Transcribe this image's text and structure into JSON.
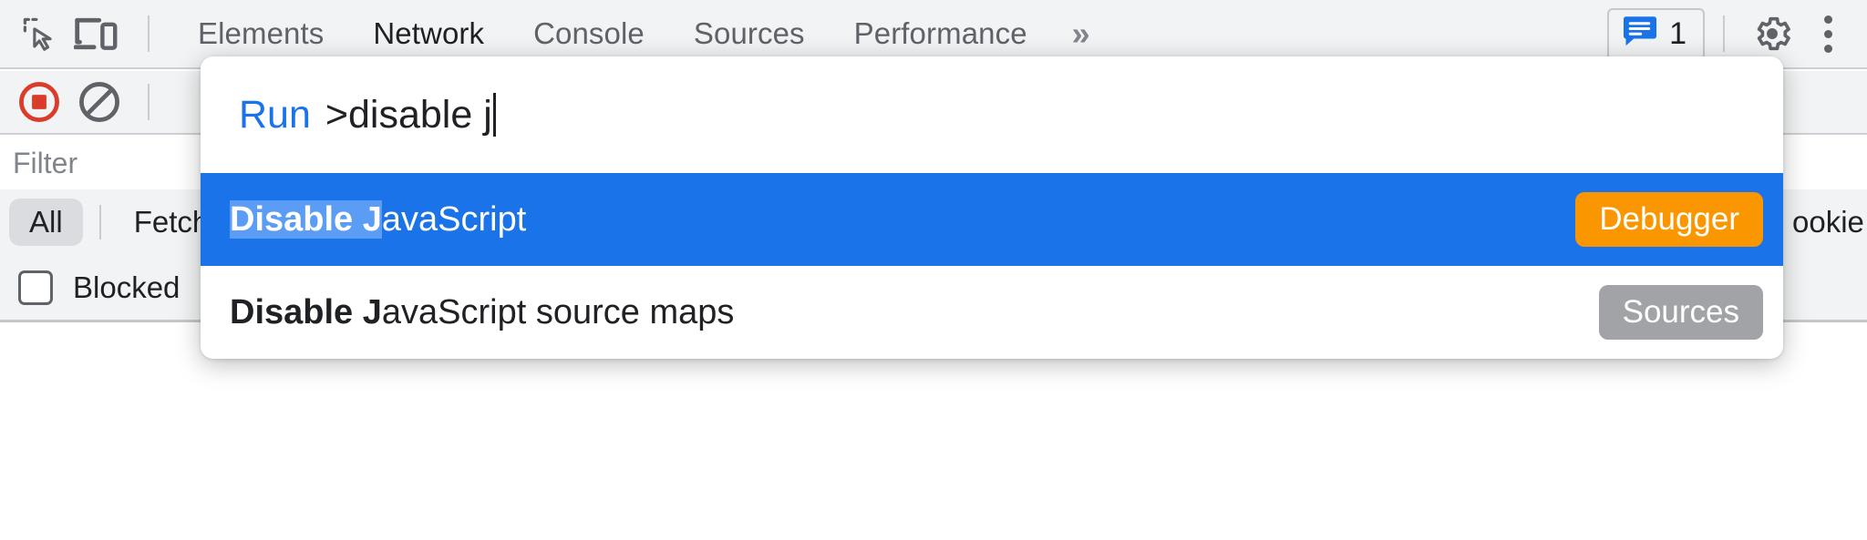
{
  "toolbar": {
    "icons": [
      {
        "name": "inspect-element-icon",
        "label": "Inspect element"
      },
      {
        "name": "device-toolbar-icon",
        "label": "Toggle device toolbar"
      }
    ],
    "tabs": [
      {
        "label": "Elements",
        "active": false
      },
      {
        "label": "Network",
        "active": true
      },
      {
        "label": "Console",
        "active": false
      },
      {
        "label": "Sources",
        "active": false
      },
      {
        "label": "Performance",
        "active": false
      }
    ],
    "more_tabs_label": "»",
    "message_count": "1",
    "message_icon": "message-bubble-icon",
    "settings_icon": "gear-icon",
    "menu_icon": "kebab-menu-icon"
  },
  "network_toolbar": {
    "record_icon": "record-stop-icon",
    "clear_icon": "clear-prohibited-icon"
  },
  "filter_bar": {
    "placeholder": "Filter",
    "value": ""
  },
  "type_filters": {
    "items": [
      {
        "label": "All",
        "selected": true
      },
      {
        "label": "Fetch",
        "selected": false
      }
    ],
    "clipped_right_label": "ookie"
  },
  "blocked_row": {
    "checkbox_label": "Blocked",
    "checked": false
  },
  "command_palette": {
    "prefix": "Run",
    "query": ">disable j",
    "results": [
      {
        "match": "Disable J",
        "rest": "avaScript",
        "tag": "Debugger",
        "tag_color": "#fa9600",
        "selected": true
      },
      {
        "match": "Disable J",
        "rest": "avaScript source maps",
        "tag": "Sources",
        "tag_color": "#a1a3a7",
        "selected": false
      }
    ]
  },
  "colors": {
    "selection_blue": "#1a73e8",
    "match_highlight": "#5b9cf5",
    "prefix_blue": "#1a73e8",
    "record_red": "#db3b2b",
    "toolbar_bg": "#f1f3f4"
  }
}
